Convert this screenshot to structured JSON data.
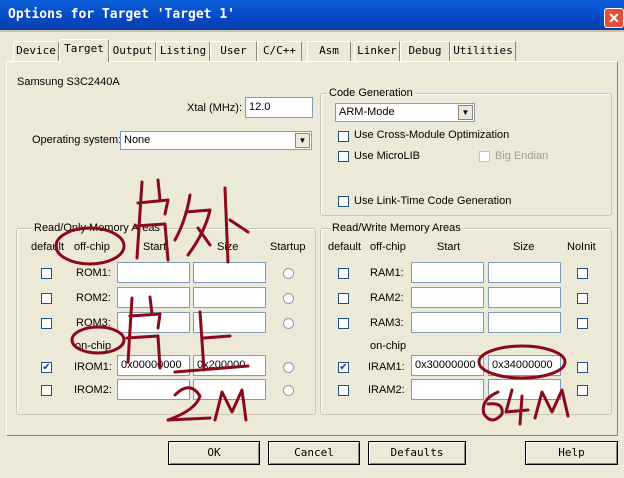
{
  "window": {
    "title": "Options for Target 'Target 1'"
  },
  "tabs": [
    "Device",
    "Target",
    "Output",
    "Listing",
    "User",
    "C/C++",
    "Asm",
    "Linker",
    "Debug",
    "Utilities"
  ],
  "active_tab": "Target",
  "device": "Samsung S3C2440A",
  "xtal": {
    "label": "Xtal (MHz):",
    "value": "12.0"
  },
  "os": {
    "label": "Operating system:",
    "value": "None"
  },
  "code_gen": {
    "title": "Code Generation",
    "mode": "ARM-Mode",
    "cross_module": "Use Cross-Module Optimization",
    "microlib": "Use MicroLIB",
    "big_endian": "Big Endian",
    "link_time": "Use Link-Time Code Generation"
  },
  "ro": {
    "title": "Read/Only Memory Areas",
    "headers": {
      "default": "default",
      "offchip": "off-chip",
      "start": "Start",
      "size": "Size",
      "startup": "Startup"
    },
    "rows": [
      "ROM1:",
      "ROM2:",
      "ROM3:",
      "IROM1:",
      "IROM2:"
    ],
    "onchip": "on-chip",
    "irom1_start": "0x00000000",
    "irom1_size": "0x200000"
  },
  "rw": {
    "title": "Read/Write Memory Areas",
    "headers": {
      "default": "default",
      "offchip": "off-chip",
      "start": "Start",
      "size": "Size",
      "noinit": "NoInit"
    },
    "rows": [
      "RAM1:",
      "RAM2:",
      "RAM3:",
      "IRAM1:",
      "IRAM2:"
    ],
    "onchip": "on-chip",
    "iram1_start": "0x30000000",
    "iram1_size": "0x34000000"
  },
  "buttons": {
    "ok": "OK",
    "cancel": "Cancel",
    "defaults": "Defaults",
    "help": "Help"
  },
  "annotation_color": "#8b0a1a"
}
